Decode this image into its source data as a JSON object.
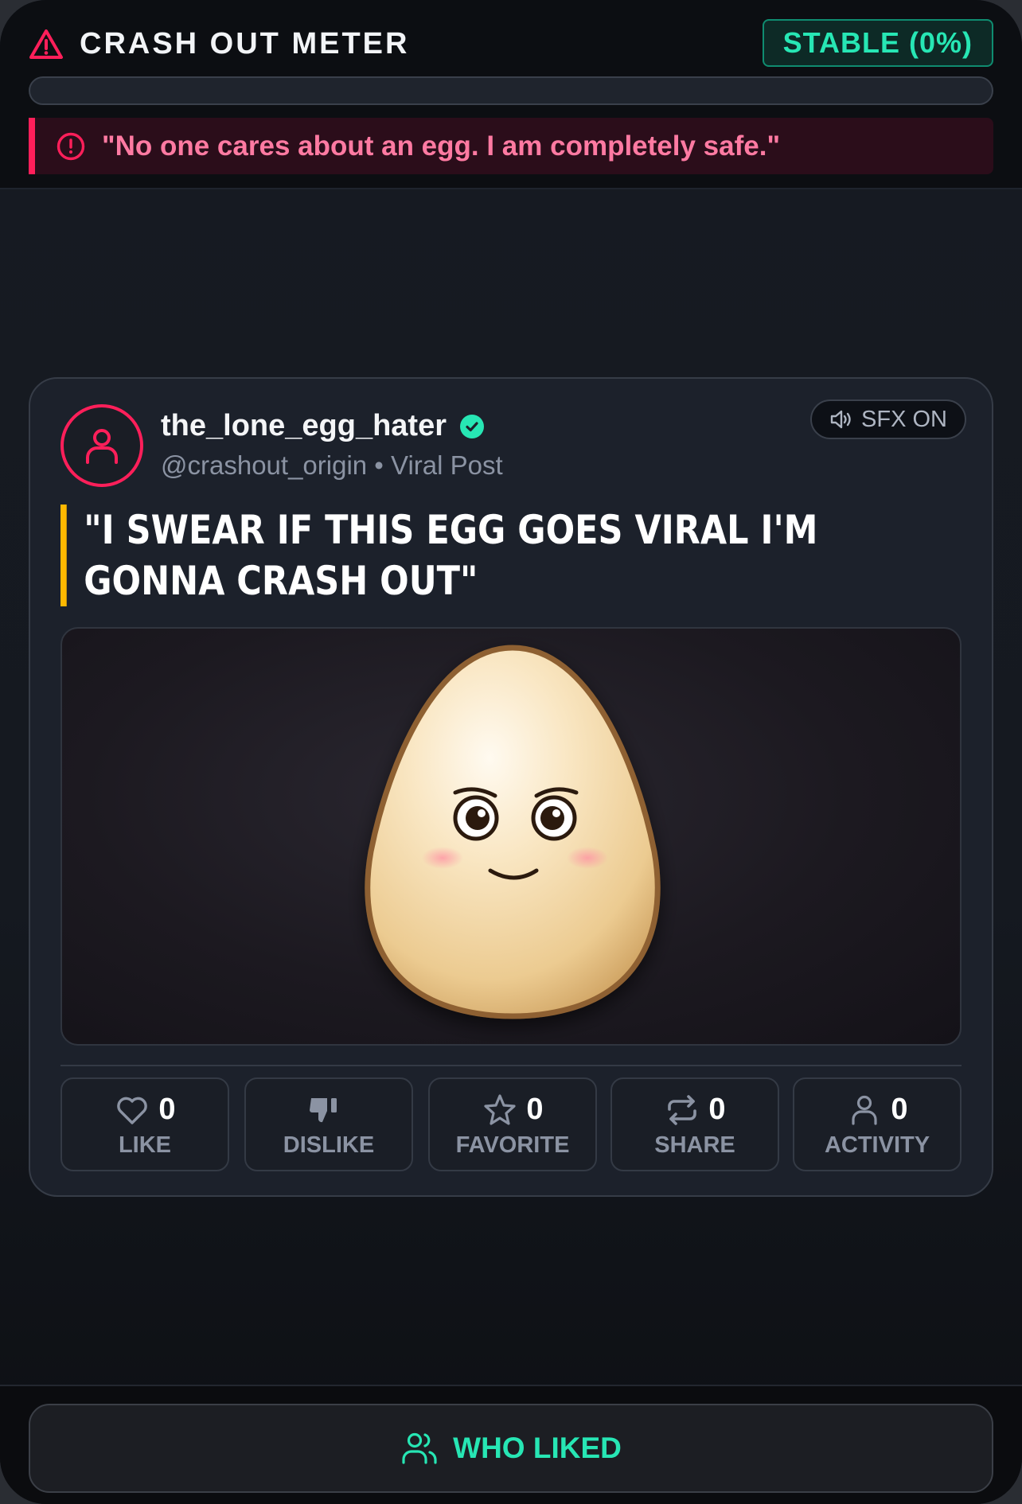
{
  "meter": {
    "title": "CRASH OUT METER",
    "status": "STABLE (0%)",
    "level_percent": 0,
    "quote": "\"No one cares about an egg. I am completely safe.\"",
    "accent_color": "#ff1f5a",
    "status_color": "#27e6b4"
  },
  "post": {
    "username": "the_lone_egg_hater",
    "handle_line": "@crashout_origin • Viral Post",
    "sfx_label": "SFX ON",
    "quote_line1": "\"I SWEAR IF THIS EGG GOES VIRAL I'M",
    "quote_line2": "GONNA CRASH OUT\"",
    "quote_accent_color": "#ffb800"
  },
  "actions": [
    {
      "icon": "heart-icon",
      "count": "0",
      "label": "LIKE"
    },
    {
      "icon": "thumbs-down-icon",
      "count": "",
      "label": "DISLIKE"
    },
    {
      "icon": "star-icon",
      "count": "0",
      "label": "FAVORITE"
    },
    {
      "icon": "repeat-icon",
      "count": "0",
      "label": "SHARE"
    },
    {
      "icon": "user-icon",
      "count": "0",
      "label": "ACTIVITY"
    }
  ],
  "bottom": {
    "who_liked_label": "WHO LIKED"
  }
}
